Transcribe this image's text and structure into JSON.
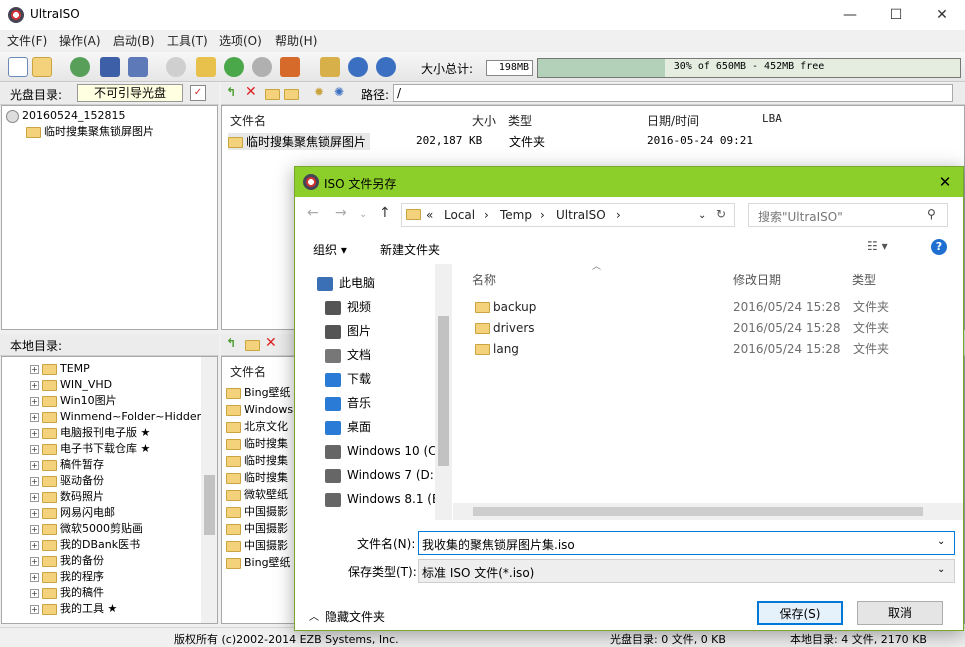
{
  "app": {
    "title": "UltraISO"
  },
  "window_buttons": {
    "min": "—",
    "max": "☐",
    "close": "✕"
  },
  "menu": [
    "文件(F)",
    "操作(A)",
    "启动(B)",
    "工具(T)",
    "选项(O)",
    "帮助(H)"
  ],
  "toolbar": {
    "size_label": "大小总计:",
    "size_value": "198MB",
    "capacity_text": "30% of 650MB - 452MB free",
    "capacity_percent": 30
  },
  "disc_panel": {
    "label": "光盘目录:",
    "boot_value": "不可引导光盘",
    "tree": [
      "20160524_152815",
      "临时搜集聚焦锁屏图片"
    ]
  },
  "iso_panel": {
    "path_label": "路径:",
    "path_value": "/",
    "columns": [
      "文件名",
      "大小",
      "类型",
      "日期/时间",
      "LBA"
    ],
    "rows": [
      {
        "name": "临时搜集聚焦锁屏图片",
        "size": "202,187 KB",
        "type": "文件夹",
        "date": "2016-05-24 09:21"
      }
    ]
  },
  "local_panel": {
    "label": "本地目录:",
    "tree": [
      "TEMP",
      "WIN_VHD",
      "Win10图片",
      "Winmend~Folder~Hidden",
      "电脑报刊电子版 ★",
      "电子书下载仓库 ★",
      "稿件暂存",
      "驱动备份",
      "数码照片",
      "网易闪电邮",
      "微软5000剪贴画",
      "我的DBank医书",
      "我的备份",
      "我的程序",
      "我的稿件",
      "我的工具 ★"
    ],
    "file_column": "文件名",
    "files": [
      "Bing壁纸",
      "Windows",
      "北京文化",
      "临时搜集",
      "临时搜集",
      "临时搜集",
      "微软壁纸",
      "中国摄影",
      "中国摄影",
      "中国摄影",
      "Bing壁纸"
    ]
  },
  "dialog": {
    "title": "ISO 文件另存",
    "breadcrumb": [
      "«",
      "Local",
      "›",
      "Temp",
      "›",
      "UltraISO",
      "›"
    ],
    "search_placeholder": "搜索\"UltraISO\"",
    "organize": "组织 ▾",
    "new_folder": "新建文件夹",
    "nav_items": [
      "此电脑",
      "视频",
      "图片",
      "文档",
      "下载",
      "音乐",
      "桌面",
      "Windows 10 (C",
      "Windows 7 (D:",
      "Windows 8.1 (E"
    ],
    "columns": {
      "name": "名称",
      "date": "修改日期",
      "type": "类型"
    },
    "files": [
      {
        "name": "backup",
        "date": "2016/05/24 15:28",
        "type": "文件夹"
      },
      {
        "name": "drivers",
        "date": "2016/05/24 15:28",
        "type": "文件夹"
      },
      {
        "name": "lang",
        "date": "2016/05/24 15:28",
        "type": "文件夹"
      }
    ],
    "filename_label": "文件名(N):",
    "filename_value": "我收集的聚焦锁屏图片集.iso",
    "filetype_label": "保存类型(T):",
    "filetype_value": "标准 ISO 文件(*.iso)",
    "hide_folders": "隐藏文件夹",
    "save": "保存(S)",
    "cancel": "取消"
  },
  "status": {
    "copyright": "版权所有 (c)2002-2014 EZB Systems, Inc.",
    "disc_info": "光盘目录: 0 文件, 0 KB",
    "local_info": "本地目录: 4 文件, 2170 KB"
  },
  "colors": {
    "dialog_title": "#8ccf2a",
    "accent": "#0078d7",
    "folder": "#f4d27b"
  }
}
